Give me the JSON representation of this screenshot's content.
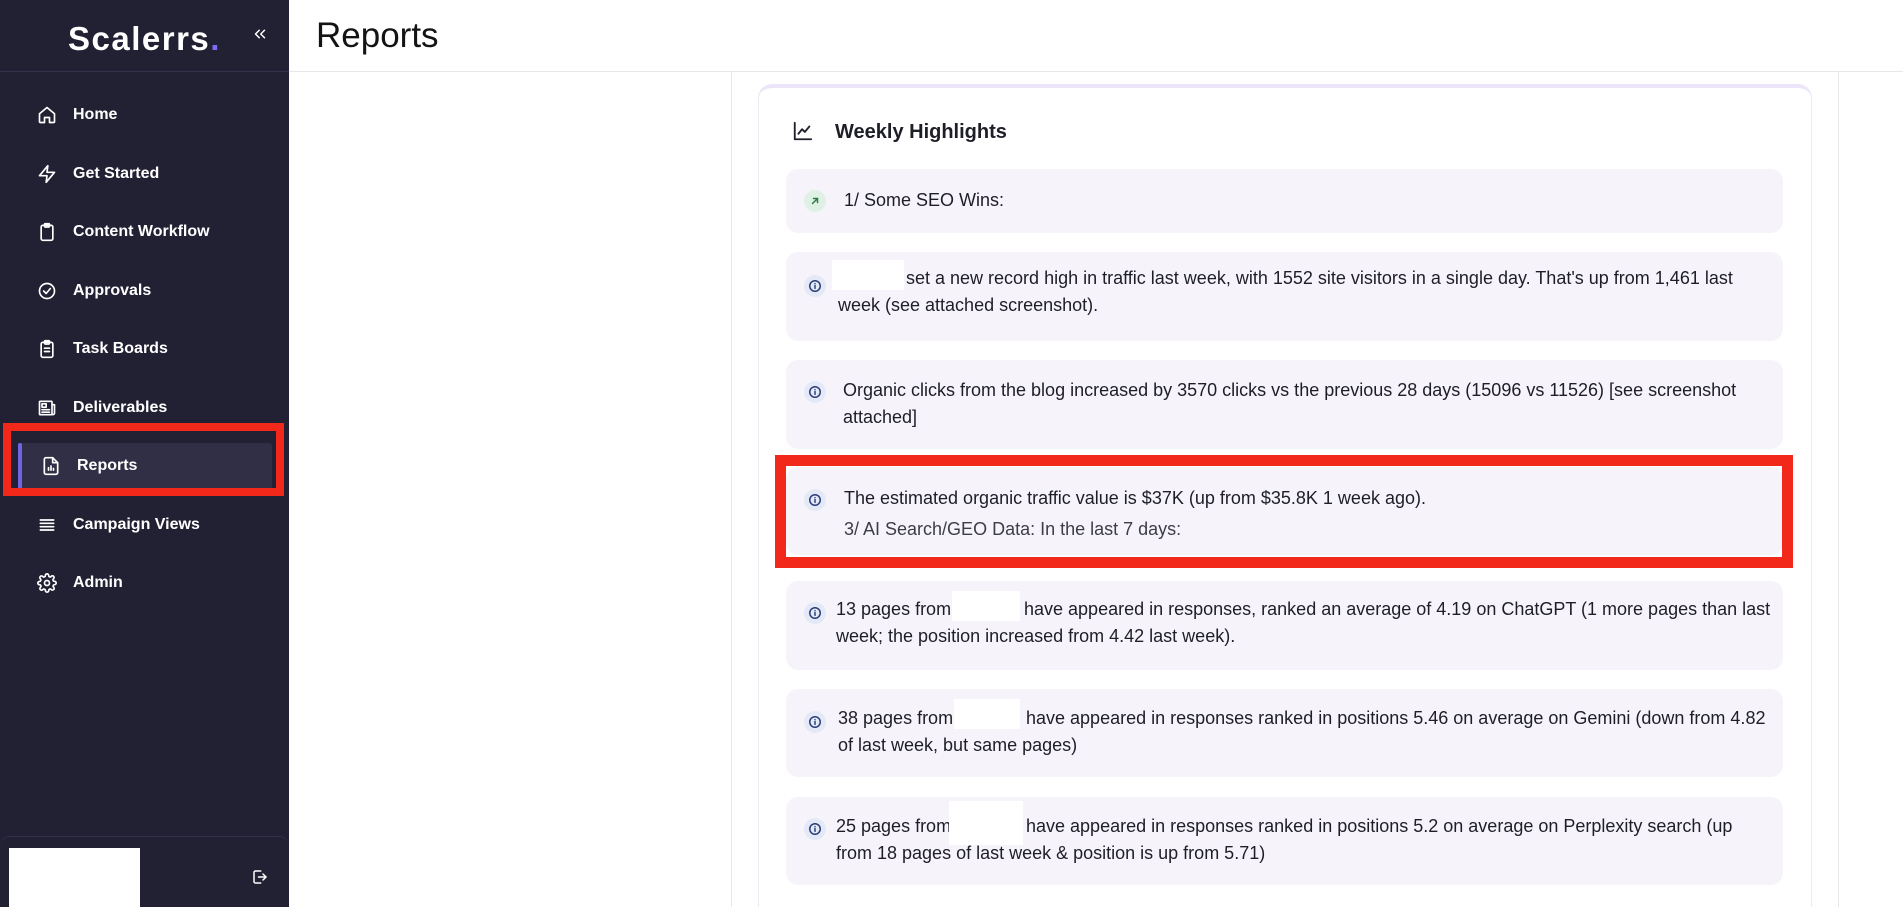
{
  "app": {
    "brand_name": "Scalerrs",
    "brand_dot": "."
  },
  "sidebar": {
    "items": [
      {
        "label": "Home",
        "icon": "home-icon"
      },
      {
        "label": "Get Started",
        "icon": "lightning-icon"
      },
      {
        "label": "Content Workflow",
        "icon": "clipboard-icon"
      },
      {
        "label": "Approvals",
        "icon": "check-circle-icon"
      },
      {
        "label": "Task Boards",
        "icon": "clipboard-list-icon"
      },
      {
        "label": "Deliverables",
        "icon": "newspaper-icon"
      },
      {
        "label": "Reports",
        "icon": "report-icon",
        "active": true
      },
      {
        "label": "Campaign Views",
        "icon": "list-icon"
      },
      {
        "label": "Admin",
        "icon": "gear-icon"
      }
    ]
  },
  "header": {
    "title": "Reports"
  },
  "card": {
    "title": "Weekly Highlights",
    "items": [
      {
        "text": "1/ Some SEO Wins:",
        "icon": "arrow-up-right-icon"
      },
      {
        "text_a": "set a new record high in traffic last week, with 1552 site visitors in a single day. That's up from 1,461 last",
        "text_b": "week (see attached screenshot).",
        "icon": "info-icon"
      },
      {
        "text_a": "Organic clicks from the blog increased by 3570 clicks vs the previous 28 days (15096 vs 11526) [see screenshot",
        "text_b": "attached]",
        "icon": "info-icon"
      },
      {
        "text_a": "The estimated organic traffic value is $37K (up from $35.8K 1 week ago).",
        "text_b": "3/ AI Search/GEO Data: In the last 7 days:",
        "icon": "info-icon"
      },
      {
        "text_pre": "13 pages from",
        "text_a": "have appeared in responses, ranked an average of 4.19 on ChatGPT (1 more pages than last",
        "text_b": "week; the position increased from 4.42 last week).",
        "icon": "info-icon"
      },
      {
        "text_pre": "38 pages from",
        "text_a": "have appeared in responses ranked in positions 5.46 on average on Gemini (down from 4.82",
        "text_b": "of last week, but same pages)",
        "icon": "info-icon"
      },
      {
        "text_pre": "25 pages from",
        "text_a": "have appeared in responses ranked in positions 5.2 on average on Perplexity search (up",
        "text_b": "from 18 pages of last week & position is up from 5.71)",
        "icon": "info-icon"
      }
    ]
  },
  "colors": {
    "sidebar_bg": "#222033",
    "accent": "#6f63e6",
    "highlight": "#f2281b",
    "item_bg": "#f6f4fa"
  }
}
